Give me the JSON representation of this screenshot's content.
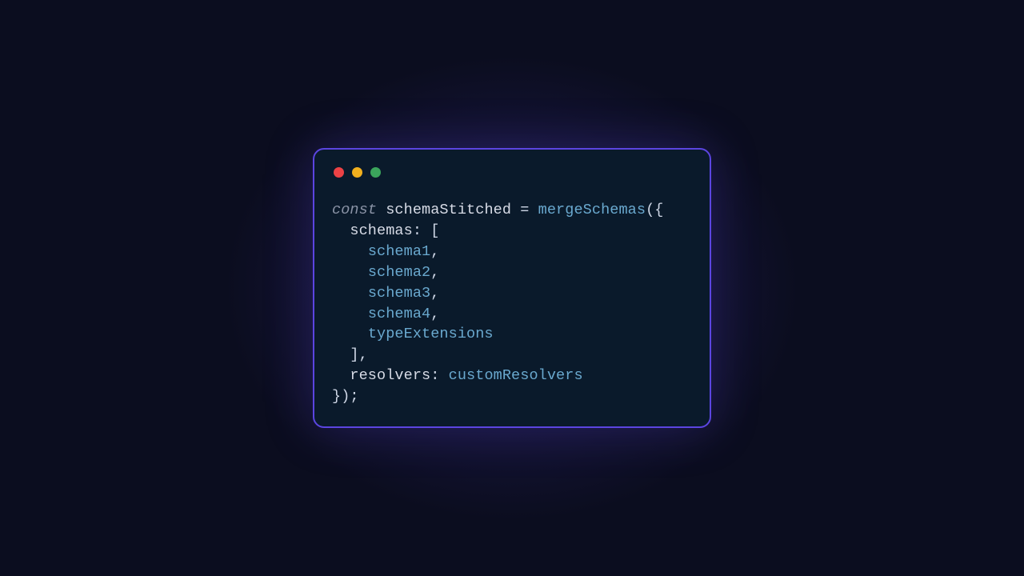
{
  "traffic_lights": {
    "red": "#ed4245",
    "yellow": "#f2b01e",
    "green": "#3ba55c"
  },
  "accent_border": "#5b45e0",
  "window_bg": "#0a1a2b",
  "page_bg": "#0b0d1f",
  "code": {
    "kw_const": "const",
    "var_schemaStitched": "schemaStitched",
    "eq": "=",
    "fn_mergeSchemas": "mergeSchemas",
    "open_call": "({",
    "prop_schemas": "schemas",
    "colon1": ":",
    "open_arr": "[",
    "item1": "schema1",
    "item2": "schema2",
    "item3": "schema3",
    "item4": "schema4",
    "item5": "typeExtensions",
    "comma": ",",
    "close_arr": "]",
    "prop_resolvers": "resolvers",
    "colon2": ":",
    "val_customResolvers": "customResolvers",
    "close_call": "});"
  }
}
